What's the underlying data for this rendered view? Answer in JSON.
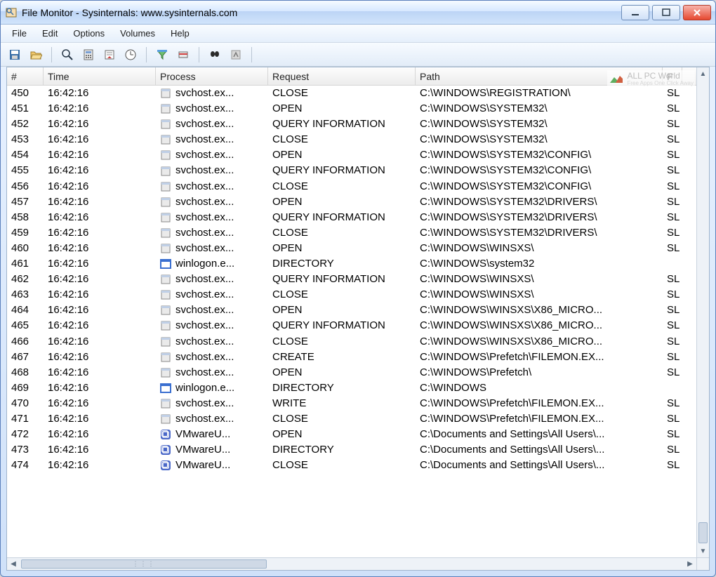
{
  "window": {
    "title": "File Monitor - Sysinternals: www.sysinternals.com"
  },
  "menubar": [
    {
      "label": "File"
    },
    {
      "label": "Edit"
    },
    {
      "label": "Options"
    },
    {
      "label": "Volumes"
    },
    {
      "label": "Help"
    }
  ],
  "toolbar": {
    "groups": [
      [
        {
          "name": "save-icon"
        },
        {
          "name": "open-icon"
        }
      ],
      [
        {
          "name": "magnify-icon"
        },
        {
          "name": "calculator-icon"
        },
        {
          "name": "autoscroll-icon"
        },
        {
          "name": "clock-icon"
        }
      ],
      [
        {
          "name": "filter-icon"
        },
        {
          "name": "highlight-icon"
        }
      ],
      [
        {
          "name": "find-icon"
        },
        {
          "name": "jump-icon"
        }
      ]
    ]
  },
  "watermark": {
    "line1": "ALL PC World",
    "line2": "Free Apps One Click Away"
  },
  "columns": {
    "num": "#",
    "time": "Time",
    "process": "Process",
    "request": "Request",
    "path": "Path",
    "result": "F"
  },
  "rows": [
    {
      "n": "450",
      "t": "16:42:16",
      "icon": "app",
      "proc": "svchost.ex...",
      "req": "CLOSE",
      "path": "C:\\WINDOWS\\REGISTRATION\\",
      "res": "SL"
    },
    {
      "n": "451",
      "t": "16:42:16",
      "icon": "app",
      "proc": "svchost.ex...",
      "req": "OPEN",
      "path": "C:\\WINDOWS\\SYSTEM32\\",
      "res": "SL"
    },
    {
      "n": "452",
      "t": "16:42:16",
      "icon": "app",
      "proc": "svchost.ex...",
      "req": "QUERY INFORMATION",
      "path": "C:\\WINDOWS\\SYSTEM32\\",
      "res": "SL"
    },
    {
      "n": "453",
      "t": "16:42:16",
      "icon": "app",
      "proc": "svchost.ex...",
      "req": "CLOSE",
      "path": "C:\\WINDOWS\\SYSTEM32\\",
      "res": "SL"
    },
    {
      "n": "454",
      "t": "16:42:16",
      "icon": "app",
      "proc": "svchost.ex...",
      "req": "OPEN",
      "path": "C:\\WINDOWS\\SYSTEM32\\CONFIG\\",
      "res": "SL"
    },
    {
      "n": "455",
      "t": "16:42:16",
      "icon": "app",
      "proc": "svchost.ex...",
      "req": "QUERY INFORMATION",
      "path": "C:\\WINDOWS\\SYSTEM32\\CONFIG\\",
      "res": "SL"
    },
    {
      "n": "456",
      "t": "16:42:16",
      "icon": "app",
      "proc": "svchost.ex...",
      "req": "CLOSE",
      "path": "C:\\WINDOWS\\SYSTEM32\\CONFIG\\",
      "res": "SL"
    },
    {
      "n": "457",
      "t": "16:42:16",
      "icon": "app",
      "proc": "svchost.ex...",
      "req": "OPEN",
      "path": "C:\\WINDOWS\\SYSTEM32\\DRIVERS\\",
      "res": "SL"
    },
    {
      "n": "458",
      "t": "16:42:16",
      "icon": "app",
      "proc": "svchost.ex...",
      "req": "QUERY INFORMATION",
      "path": "C:\\WINDOWS\\SYSTEM32\\DRIVERS\\",
      "res": "SL"
    },
    {
      "n": "459",
      "t": "16:42:16",
      "icon": "app",
      "proc": "svchost.ex...",
      "req": "CLOSE",
      "path": "C:\\WINDOWS\\SYSTEM32\\DRIVERS\\",
      "res": "SL"
    },
    {
      "n": "460",
      "t": "16:42:16",
      "icon": "app",
      "proc": "svchost.ex...",
      "req": "OPEN",
      "path": "C:\\WINDOWS\\WINSXS\\",
      "res": "SL"
    },
    {
      "n": "461",
      "t": "16:42:16",
      "icon": "win",
      "proc": "winlogon.e...",
      "req": "DIRECTORY",
      "path": "C:\\WINDOWS\\system32",
      "res": ""
    },
    {
      "n": "462",
      "t": "16:42:16",
      "icon": "app",
      "proc": "svchost.ex...",
      "req": "QUERY INFORMATION",
      "path": "C:\\WINDOWS\\WINSXS\\",
      "res": "SL"
    },
    {
      "n": "463",
      "t": "16:42:16",
      "icon": "app",
      "proc": "svchost.ex...",
      "req": "CLOSE",
      "path": "C:\\WINDOWS\\WINSXS\\",
      "res": "SL"
    },
    {
      "n": "464",
      "t": "16:42:16",
      "icon": "app",
      "proc": "svchost.ex...",
      "req": "OPEN",
      "path": "C:\\WINDOWS\\WINSXS\\X86_MICRO...",
      "res": "SL"
    },
    {
      "n": "465",
      "t": "16:42:16",
      "icon": "app",
      "proc": "svchost.ex...",
      "req": "QUERY INFORMATION",
      "path": "C:\\WINDOWS\\WINSXS\\X86_MICRO...",
      "res": "SL"
    },
    {
      "n": "466",
      "t": "16:42:16",
      "icon": "app",
      "proc": "svchost.ex...",
      "req": "CLOSE",
      "path": "C:\\WINDOWS\\WINSXS\\X86_MICRO...",
      "res": "SL"
    },
    {
      "n": "467",
      "t": "16:42:16",
      "icon": "app",
      "proc": "svchost.ex...",
      "req": "CREATE",
      "path": "C:\\WINDOWS\\Prefetch\\FILEMON.EX...",
      "res": "SL"
    },
    {
      "n": "468",
      "t": "16:42:16",
      "icon": "app",
      "proc": "svchost.ex...",
      "req": "OPEN",
      "path": "C:\\WINDOWS\\Prefetch\\",
      "res": "SL"
    },
    {
      "n": "469",
      "t": "16:42:16",
      "icon": "win",
      "proc": "winlogon.e...",
      "req": "DIRECTORY",
      "path": "C:\\WINDOWS",
      "res": ""
    },
    {
      "n": "470",
      "t": "16:42:16",
      "icon": "app",
      "proc": "svchost.ex...",
      "req": "WRITE",
      "path": "C:\\WINDOWS\\Prefetch\\FILEMON.EX...",
      "res": "SL"
    },
    {
      "n": "471",
      "t": "16:42:16",
      "icon": "app",
      "proc": "svchost.ex...",
      "req": "CLOSE",
      "path": "C:\\WINDOWS\\Prefetch\\FILEMON.EX...",
      "res": "SL"
    },
    {
      "n": "472",
      "t": "16:42:16",
      "icon": "vm",
      "proc": "VMwareU...",
      "req": "OPEN",
      "path": "C:\\Documents and Settings\\All Users\\...",
      "res": "SL"
    },
    {
      "n": "473",
      "t": "16:42:16",
      "icon": "vm",
      "proc": "VMwareU...",
      "req": "DIRECTORY",
      "path": "C:\\Documents and Settings\\All Users\\...",
      "res": "SL"
    },
    {
      "n": "474",
      "t": "16:42:16",
      "icon": "vm",
      "proc": "VMwareU...",
      "req": "CLOSE",
      "path": "C:\\Documents and Settings\\All Users\\...",
      "res": "SL"
    }
  ]
}
